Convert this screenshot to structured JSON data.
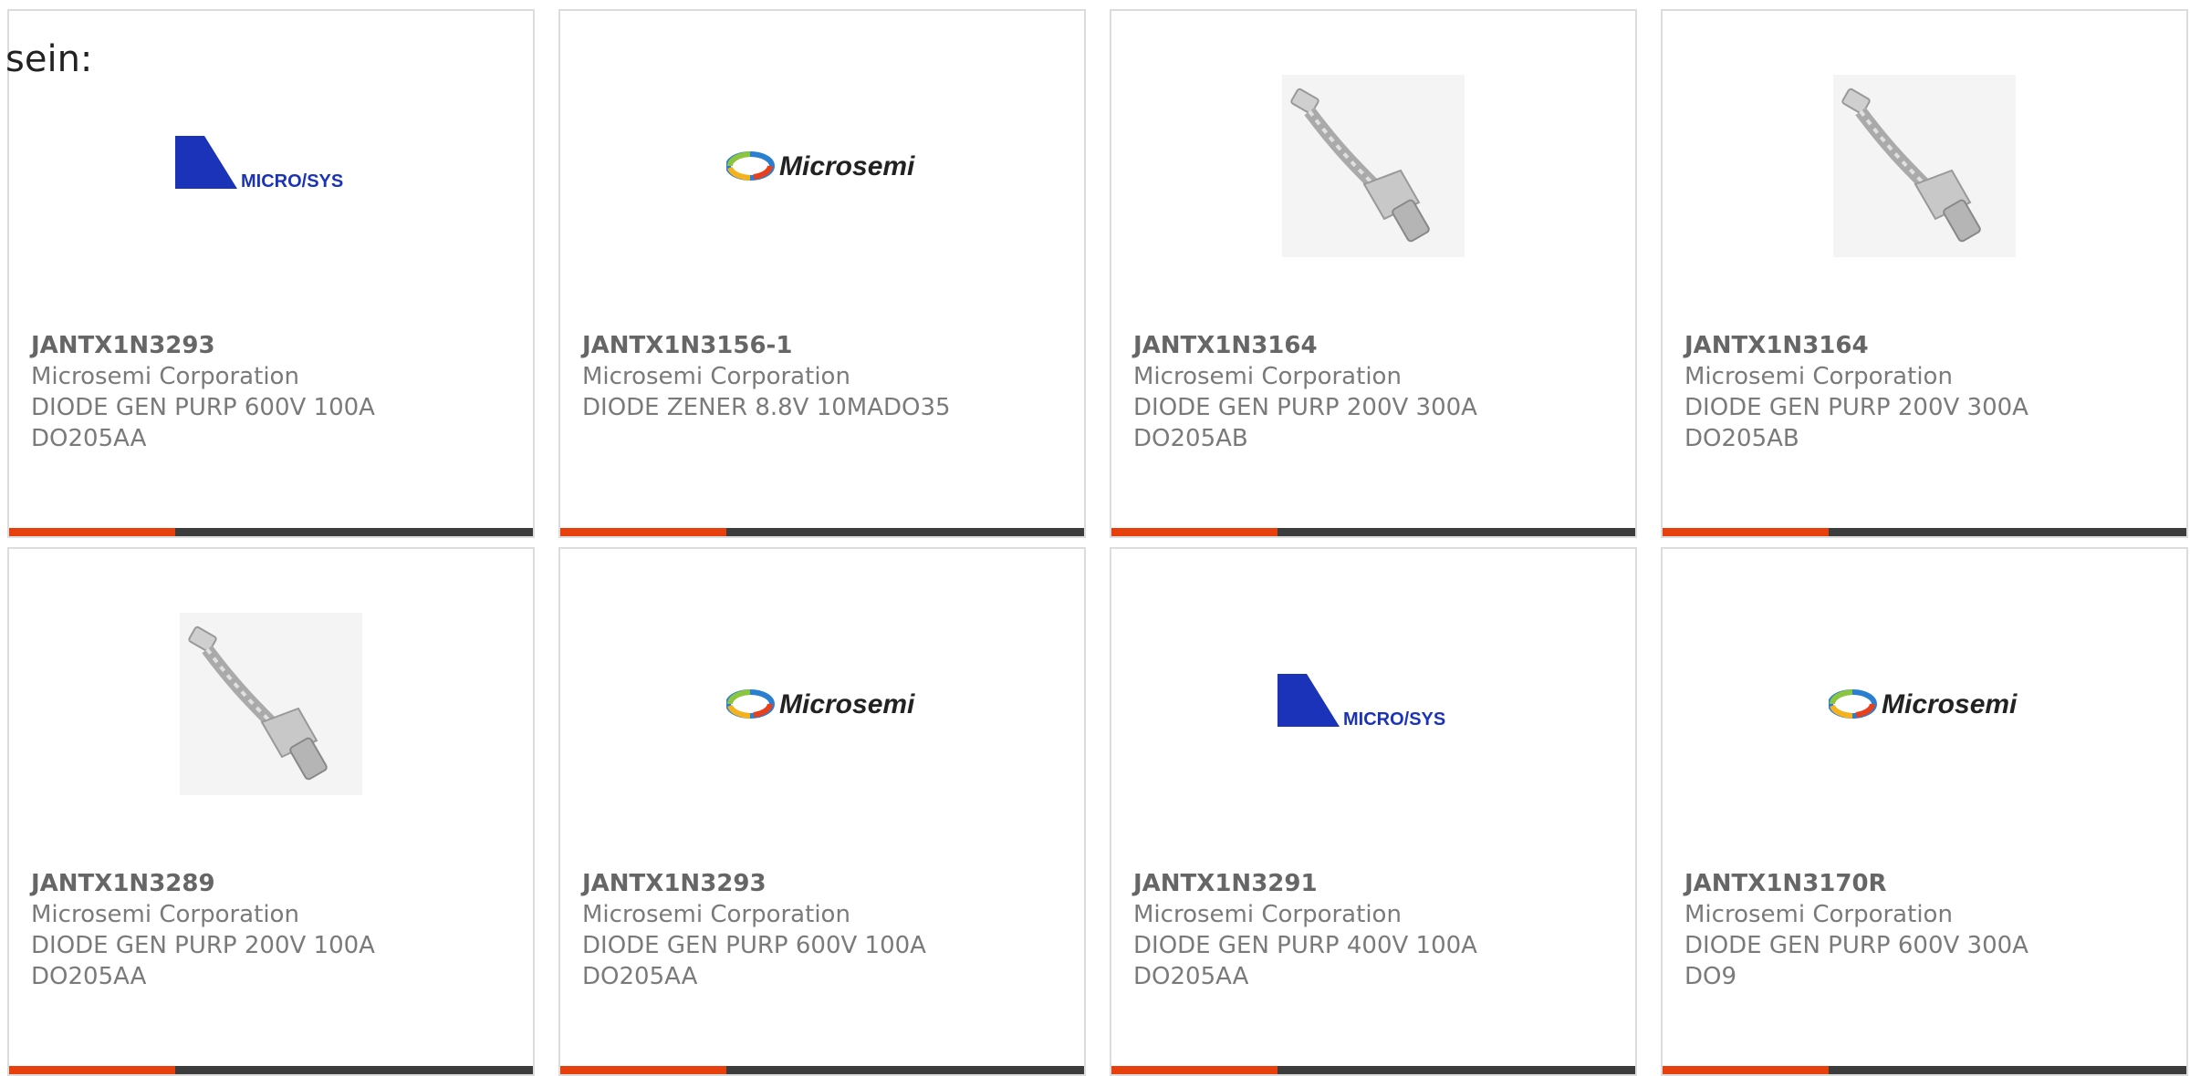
{
  "heading": "sein:",
  "colors": {
    "accent": "#e8400c",
    "bar": "#3c3c3c"
  },
  "products": [
    {
      "part": "JANTX1N3293",
      "maker": "Microsemi Corporation",
      "desc": "DIODE GEN PURP 600V 100A",
      "pkg": "DO205AA",
      "image": "microsys-logo"
    },
    {
      "part": "JANTX1N3156-1",
      "maker": "Microsemi Corporation",
      "desc": "DIODE ZENER 8.8V 10MADO35",
      "pkg": "",
      "image": "microsemi-logo"
    },
    {
      "part": "JANTX1N3164",
      "maker": "Microsemi Corporation",
      "desc": "DIODE GEN PURP 200V 300A",
      "pkg": "DO205AB",
      "image": "stud-diode-photo"
    },
    {
      "part": "JANTX1N3164",
      "maker": "Microsemi Corporation",
      "desc": "DIODE GEN PURP 200V 300A",
      "pkg": "DO205AB",
      "image": "stud-diode-photo"
    },
    {
      "part": "JANTX1N3289",
      "maker": "Microsemi Corporation",
      "desc": "DIODE GEN PURP 200V 100A",
      "pkg": "DO205AA",
      "image": "stud-diode-photo"
    },
    {
      "part": "JANTX1N3293",
      "maker": "Microsemi Corporation",
      "desc": "DIODE GEN PURP 600V 100A",
      "pkg": "DO205AA",
      "image": "microsemi-logo"
    },
    {
      "part": "JANTX1N3291",
      "maker": "Microsemi Corporation",
      "desc": "DIODE GEN PURP 400V 100A",
      "pkg": "DO205AA",
      "image": "microsys-logo"
    },
    {
      "part": "JANTX1N3170R",
      "maker": "Microsemi Corporation",
      "desc": "DIODE GEN PURP 600V 300A",
      "pkg": "DO9",
      "image": "microsemi-logo"
    }
  ],
  "logos": {
    "microsys": "MICRO/SYS",
    "microsemi": "Microsemi"
  }
}
